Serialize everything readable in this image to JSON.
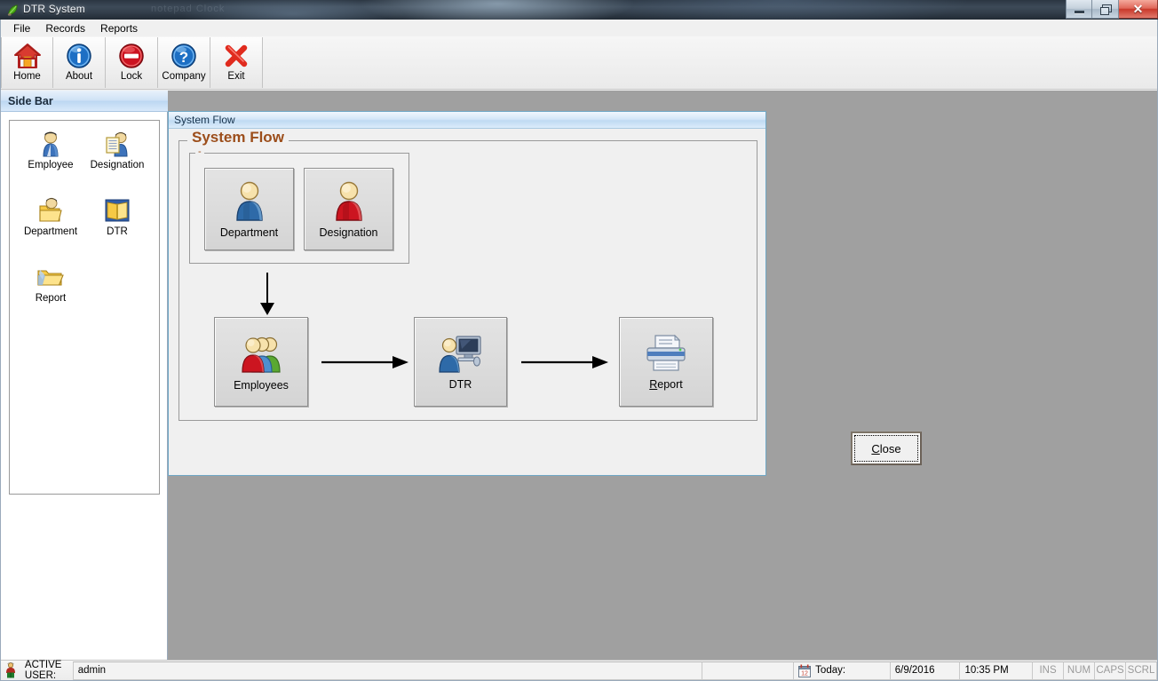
{
  "window": {
    "title": "DTR System",
    "ghost_text": "notepad  Clock",
    "icon": "app-leaf-icon",
    "controls": {
      "minimize": "minimize-icon",
      "restore": "restore-icon",
      "close": "close-icon",
      "close_glyph": "✕"
    }
  },
  "menubar": {
    "items": [
      {
        "label": "File",
        "name": "menu-file"
      },
      {
        "label": "Records",
        "name": "menu-records"
      },
      {
        "label": "Reports",
        "name": "menu-reports"
      }
    ]
  },
  "toolbar": {
    "buttons": [
      {
        "label": "Home",
        "icon": "home-icon",
        "name": "toolbar-home"
      },
      {
        "label": "About",
        "icon": "info-icon",
        "name": "toolbar-about"
      },
      {
        "label": "Lock",
        "icon": "lock-deny-icon",
        "name": "toolbar-lock"
      },
      {
        "label": "Company",
        "icon": "question-icon",
        "name": "toolbar-company"
      },
      {
        "label": "Exit",
        "icon": "red-x-icon",
        "name": "toolbar-exit"
      }
    ]
  },
  "sidebar": {
    "header": "Side Bar",
    "items": [
      {
        "label": "Employee",
        "icon": "user-blue-icon",
        "name": "sidebar-item-employee"
      },
      {
        "label": "Designation",
        "icon": "user-list-icon",
        "name": "sidebar-item-designation"
      },
      {
        "label": "Department",
        "icon": "user-folder-icon",
        "name": "sidebar-item-department"
      },
      {
        "label": "DTR",
        "icon": "book-icon",
        "name": "sidebar-item-dtr"
      },
      {
        "label": "Report",
        "icon": "folder-open-icon",
        "name": "sidebar-item-report"
      }
    ]
  },
  "mdi": {
    "title": "System Flow",
    "group_title": "System Flow",
    "inner_group_title": "-",
    "top_buttons": [
      {
        "label": "Department",
        "icon": "person-blue-icon",
        "name": "flow-department-button"
      },
      {
        "label": "Designation",
        "icon": "person-red-icon",
        "name": "flow-designation-button"
      }
    ],
    "flow_buttons": [
      {
        "label": "Employees",
        "accel": "",
        "icon": "people-group-icon",
        "name": "flow-employees-button"
      },
      {
        "label": "DTR",
        "accel": "",
        "icon": "computer-user-icon",
        "name": "flow-dtr-button"
      },
      {
        "label": "Report",
        "accel": "R",
        "icon": "printer-icon",
        "name": "flow-report-button"
      }
    ],
    "close_button": {
      "accel": "C",
      "rest": "lose",
      "label": "Close",
      "name": "close-button"
    }
  },
  "statusbar": {
    "user_icon": "user-status-icon",
    "active_user_label": "ACTIVE USER:",
    "active_user_value": "admin",
    "calendar_icon": "calendar-icon",
    "today_label": "Today:",
    "date": "6/9/2016",
    "time": "10:35 PM",
    "indicators": [
      "INS",
      "NUM",
      "CAPS",
      "SCRL"
    ]
  },
  "colors": {
    "accent_orange": "#9c4e1b",
    "title_blue": "#bfdaf2",
    "workspace_gray": "#a0a0a0"
  }
}
